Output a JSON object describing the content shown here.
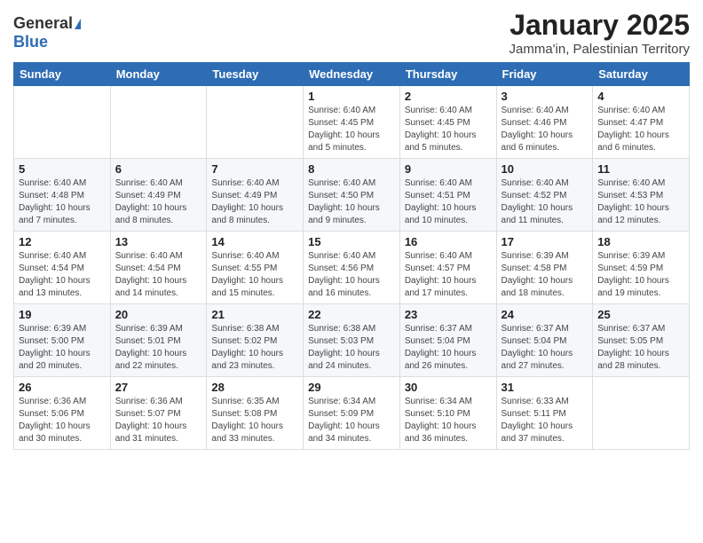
{
  "header": {
    "logo_general": "General",
    "logo_blue": "Blue",
    "title": "January 2025",
    "subtitle": "Jamma'in, Palestinian Territory"
  },
  "days_of_week": [
    "Sunday",
    "Monday",
    "Tuesday",
    "Wednesday",
    "Thursday",
    "Friday",
    "Saturday"
  ],
  "weeks": [
    [
      {
        "day": "",
        "info": ""
      },
      {
        "day": "",
        "info": ""
      },
      {
        "day": "",
        "info": ""
      },
      {
        "day": "1",
        "info": "Sunrise: 6:40 AM\nSunset: 4:45 PM\nDaylight: 10 hours\nand 5 minutes."
      },
      {
        "day": "2",
        "info": "Sunrise: 6:40 AM\nSunset: 4:45 PM\nDaylight: 10 hours\nand 5 minutes."
      },
      {
        "day": "3",
        "info": "Sunrise: 6:40 AM\nSunset: 4:46 PM\nDaylight: 10 hours\nand 6 minutes."
      },
      {
        "day": "4",
        "info": "Sunrise: 6:40 AM\nSunset: 4:47 PM\nDaylight: 10 hours\nand 6 minutes."
      }
    ],
    [
      {
        "day": "5",
        "info": "Sunrise: 6:40 AM\nSunset: 4:48 PM\nDaylight: 10 hours\nand 7 minutes."
      },
      {
        "day": "6",
        "info": "Sunrise: 6:40 AM\nSunset: 4:49 PM\nDaylight: 10 hours\nand 8 minutes."
      },
      {
        "day": "7",
        "info": "Sunrise: 6:40 AM\nSunset: 4:49 PM\nDaylight: 10 hours\nand 8 minutes."
      },
      {
        "day": "8",
        "info": "Sunrise: 6:40 AM\nSunset: 4:50 PM\nDaylight: 10 hours\nand 9 minutes."
      },
      {
        "day": "9",
        "info": "Sunrise: 6:40 AM\nSunset: 4:51 PM\nDaylight: 10 hours\nand 10 minutes."
      },
      {
        "day": "10",
        "info": "Sunrise: 6:40 AM\nSunset: 4:52 PM\nDaylight: 10 hours\nand 11 minutes."
      },
      {
        "day": "11",
        "info": "Sunrise: 6:40 AM\nSunset: 4:53 PM\nDaylight: 10 hours\nand 12 minutes."
      }
    ],
    [
      {
        "day": "12",
        "info": "Sunrise: 6:40 AM\nSunset: 4:54 PM\nDaylight: 10 hours\nand 13 minutes."
      },
      {
        "day": "13",
        "info": "Sunrise: 6:40 AM\nSunset: 4:54 PM\nDaylight: 10 hours\nand 14 minutes."
      },
      {
        "day": "14",
        "info": "Sunrise: 6:40 AM\nSunset: 4:55 PM\nDaylight: 10 hours\nand 15 minutes."
      },
      {
        "day": "15",
        "info": "Sunrise: 6:40 AM\nSunset: 4:56 PM\nDaylight: 10 hours\nand 16 minutes."
      },
      {
        "day": "16",
        "info": "Sunrise: 6:40 AM\nSunset: 4:57 PM\nDaylight: 10 hours\nand 17 minutes."
      },
      {
        "day": "17",
        "info": "Sunrise: 6:39 AM\nSunset: 4:58 PM\nDaylight: 10 hours\nand 18 minutes."
      },
      {
        "day": "18",
        "info": "Sunrise: 6:39 AM\nSunset: 4:59 PM\nDaylight: 10 hours\nand 19 minutes."
      }
    ],
    [
      {
        "day": "19",
        "info": "Sunrise: 6:39 AM\nSunset: 5:00 PM\nDaylight: 10 hours\nand 20 minutes."
      },
      {
        "day": "20",
        "info": "Sunrise: 6:39 AM\nSunset: 5:01 PM\nDaylight: 10 hours\nand 22 minutes."
      },
      {
        "day": "21",
        "info": "Sunrise: 6:38 AM\nSunset: 5:02 PM\nDaylight: 10 hours\nand 23 minutes."
      },
      {
        "day": "22",
        "info": "Sunrise: 6:38 AM\nSunset: 5:03 PM\nDaylight: 10 hours\nand 24 minutes."
      },
      {
        "day": "23",
        "info": "Sunrise: 6:37 AM\nSunset: 5:04 PM\nDaylight: 10 hours\nand 26 minutes."
      },
      {
        "day": "24",
        "info": "Sunrise: 6:37 AM\nSunset: 5:04 PM\nDaylight: 10 hours\nand 27 minutes."
      },
      {
        "day": "25",
        "info": "Sunrise: 6:37 AM\nSunset: 5:05 PM\nDaylight: 10 hours\nand 28 minutes."
      }
    ],
    [
      {
        "day": "26",
        "info": "Sunrise: 6:36 AM\nSunset: 5:06 PM\nDaylight: 10 hours\nand 30 minutes."
      },
      {
        "day": "27",
        "info": "Sunrise: 6:36 AM\nSunset: 5:07 PM\nDaylight: 10 hours\nand 31 minutes."
      },
      {
        "day": "28",
        "info": "Sunrise: 6:35 AM\nSunset: 5:08 PM\nDaylight: 10 hours\nand 33 minutes."
      },
      {
        "day": "29",
        "info": "Sunrise: 6:34 AM\nSunset: 5:09 PM\nDaylight: 10 hours\nand 34 minutes."
      },
      {
        "day": "30",
        "info": "Sunrise: 6:34 AM\nSunset: 5:10 PM\nDaylight: 10 hours\nand 36 minutes."
      },
      {
        "day": "31",
        "info": "Sunrise: 6:33 AM\nSunset: 5:11 PM\nDaylight: 10 hours\nand 37 minutes."
      },
      {
        "day": "",
        "info": ""
      }
    ]
  ]
}
